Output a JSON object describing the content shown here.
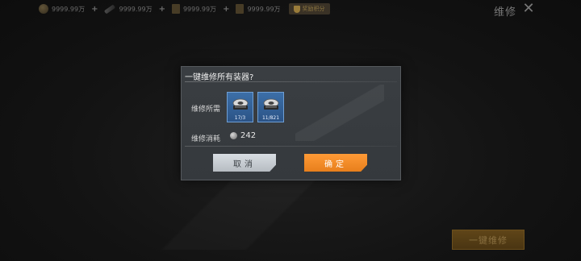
{
  "topbar": {
    "resources": [
      {
        "icon": "gold-coin-icon",
        "value": "9999.99万"
      },
      {
        "icon": "rifle-icon",
        "value": "9999.99万"
      },
      {
        "icon": "medkit-icon",
        "value": "9999.99万"
      },
      {
        "icon": "medal-icon",
        "value": "9999.99万"
      }
    ],
    "reward_label": "奖励积分"
  },
  "header": {
    "title": "维修",
    "close_icon": "close-icon"
  },
  "background": {
    "repair_all_button": "一键维修"
  },
  "dialog": {
    "title": "一键维修所有装器?",
    "required_label": "维修所需",
    "items": [
      {
        "icon": "repair-part-icon",
        "count": "17/3"
      },
      {
        "icon": "repair-part-icon",
        "count": "11/821"
      }
    ],
    "cost_label": "维修消耗",
    "cost_icon": "silver-coin-icon",
    "cost_value": "242",
    "cancel_label": "取消",
    "confirm_label": "确定"
  },
  "colors": {
    "confirm": "#f08a27",
    "cancel": "#c9cfd4",
    "item_bg": "#3563a0",
    "dialog_bg": "#383c40"
  }
}
